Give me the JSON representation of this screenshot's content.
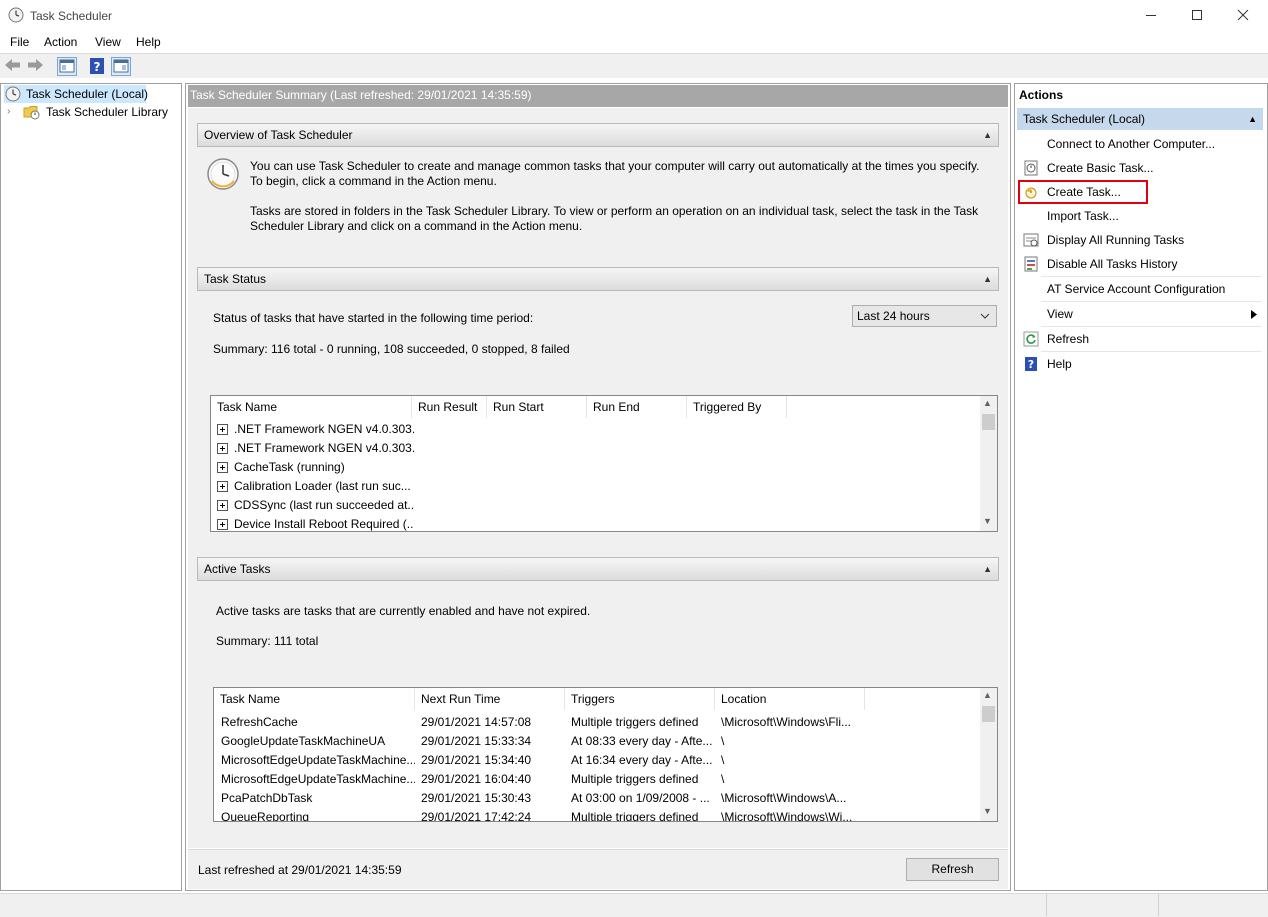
{
  "window": {
    "title": "Task Scheduler"
  },
  "menu": [
    "File",
    "Action",
    "View",
    "Help"
  ],
  "tree": {
    "root": "Task Scheduler (Local)",
    "library": "Task Scheduler Library"
  },
  "center": {
    "header": "Task Scheduler Summary (Last refreshed: 29/01/2021 14:35:59)",
    "overview": {
      "title": "Overview of Task Scheduler",
      "line1": "You can use Task Scheduler to create and manage common tasks that your computer will carry out automatically at the times you specify.",
      "line2": "To begin, click a command in the Action menu.",
      "line3": "Tasks are stored in folders in the Task Scheduler Library. To view or perform an operation on an individual task, select the task in the Task",
      "line4": "Scheduler Library and click on a command in the Action menu."
    },
    "status": {
      "title": "Task Status",
      "period_label": "Status of tasks that have started in the following time period:",
      "period_value": "Last 24 hours",
      "summary": "Summary: 116 total - 0 running, 108 succeeded, 0 stopped, 8 failed",
      "columns": [
        "Task Name",
        "Run Result",
        "Run Start",
        "Run End",
        "Triggered By"
      ],
      "rows": [
        ".NET Framework NGEN v4.0.303...",
        ".NET Framework NGEN v4.0.303...",
        "CacheTask (running)",
        "Calibration Loader (last run suc...",
        "CDSSync (last run succeeded at...",
        "Device Install Reboot Required (..."
      ]
    },
    "active": {
      "title": "Active Tasks",
      "description": "Active tasks are tasks that are currently enabled and have not expired.",
      "summary": "Summary: 111 total",
      "columns": [
        "Task Name",
        "Next Run Time",
        "Triggers",
        "Location"
      ],
      "rows": [
        [
          "RefreshCache",
          "29/01/2021 14:57:08",
          "Multiple triggers defined",
          "\\Microsoft\\Windows\\Fli..."
        ],
        [
          "GoogleUpdateTaskMachineUA",
          "29/01/2021 15:33:34",
          "At 08:33 every day - Afte...",
          "\\"
        ],
        [
          "MicrosoftEdgeUpdateTaskMachine...",
          "29/01/2021 15:34:40",
          "At 16:34 every day - Afte...",
          "\\"
        ],
        [
          "MicrosoftEdgeUpdateTaskMachine...",
          "29/01/2021 16:04:40",
          "Multiple triggers defined",
          "\\"
        ],
        [
          "PcaPatchDbTask",
          "29/01/2021 15:30:43",
          "At 03:00 on 1/09/2008 - ...",
          "\\Microsoft\\Windows\\A..."
        ],
        [
          "QueueReporting",
          "29/01/2021 17:42:24",
          "Multiple triggers defined",
          "\\Microsoft\\Windows\\Wi..."
        ]
      ]
    },
    "footer": {
      "last_refreshed": "Last refreshed at 29/01/2021 14:35:59",
      "refresh_button": "Refresh"
    }
  },
  "actions": {
    "title": "Actions",
    "group": "Task Scheduler (Local)",
    "items": [
      "Connect to Another Computer...",
      "Create Basic Task...",
      "Create Task...",
      "Import Task...",
      "Display All Running Tasks",
      "Disable All Tasks History",
      "AT Service Account Configuration",
      "View",
      "Refresh",
      "Help"
    ],
    "highlight_color": "#e2000f"
  }
}
